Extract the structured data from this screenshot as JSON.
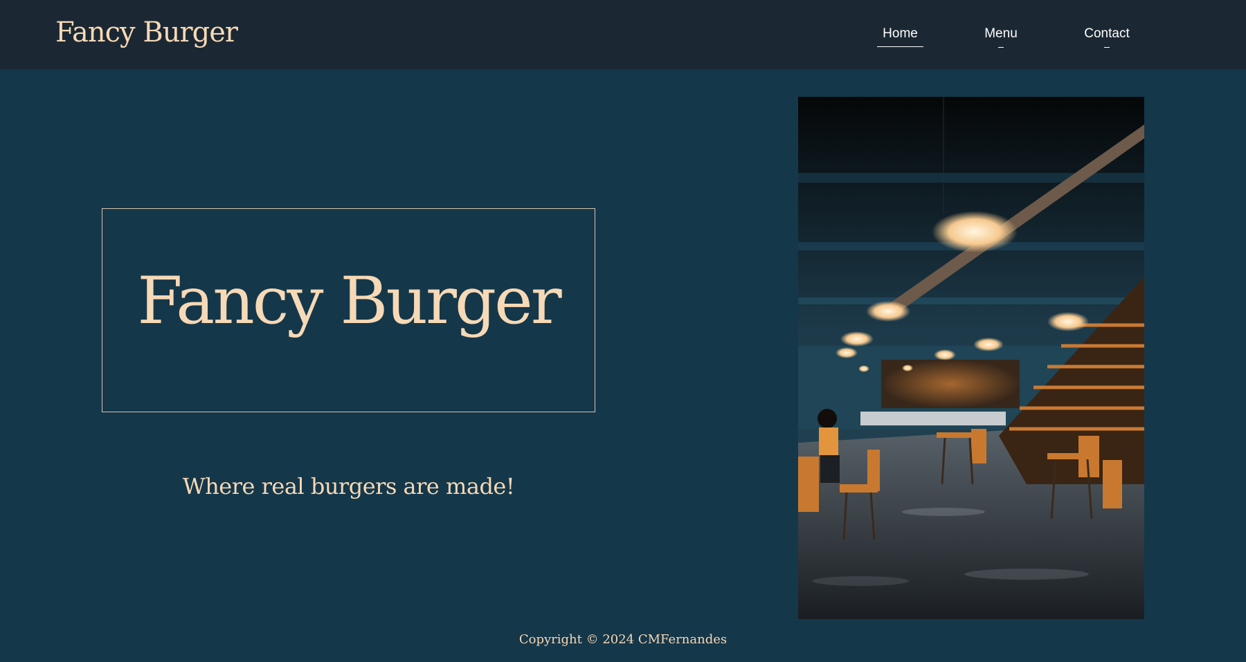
{
  "header": {
    "brand": "Fancy Burger",
    "nav": [
      {
        "label": "Home"
      },
      {
        "label": "Menu"
      },
      {
        "label": "Contact"
      }
    ]
  },
  "hero": {
    "title": "Fancy Burger",
    "tagline": "Where real burgers are made!"
  },
  "footer": {
    "copyright": "Copyright © 2024 CMFernandes"
  },
  "colors": {
    "page_background": "#15374a",
    "header_background": "#1b2833",
    "accent_text": "#f6d9b6"
  }
}
